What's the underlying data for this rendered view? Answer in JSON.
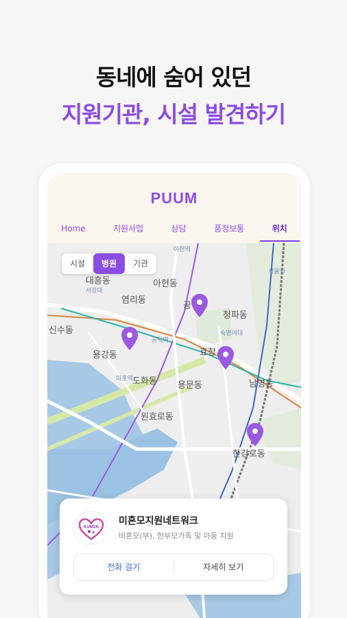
{
  "headline": {
    "line1": "동네에 숨어 있던",
    "line2": "지원기관, 시설 발견하기"
  },
  "app": {
    "logo": "PUUM",
    "tabs": [
      "Home",
      "지원사업",
      "상담",
      "품정보통",
      "위치"
    ],
    "active_tab": "위치",
    "accent_color": "#8b4ce3"
  },
  "map": {
    "filters": [
      "시설",
      "병원",
      "기관"
    ],
    "active_filter": "병원",
    "labels": {
      "daeheung": "대흥동",
      "yeomni": "염리동",
      "ahyeon": "아현동",
      "sinsu": "신수동",
      "yonggang": "용강동",
      "dohwa": "도화동",
      "yongmun": "용문동",
      "wonhyo": "원효로동",
      "cheongpa": "청파동",
      "hyochang": "효창",
      "namyeong": "남영동",
      "hangang": "한강로동",
      "gong": "공",
      "ahyeon_station": "아현역",
      "mapo": "마포역",
      "gongdeok": "공덕역",
      "sookmyung": "숙명여대",
      "seoul_station": "서울역",
      "seogang": "서강대"
    }
  },
  "facility": {
    "logo_text": "KUMSN",
    "name": "미혼모지원네트워크",
    "description": "비혼모(부), 한부모가족 및 아동 지원",
    "call_label": "전화 걸기",
    "detail_label": "자세히 보기"
  }
}
